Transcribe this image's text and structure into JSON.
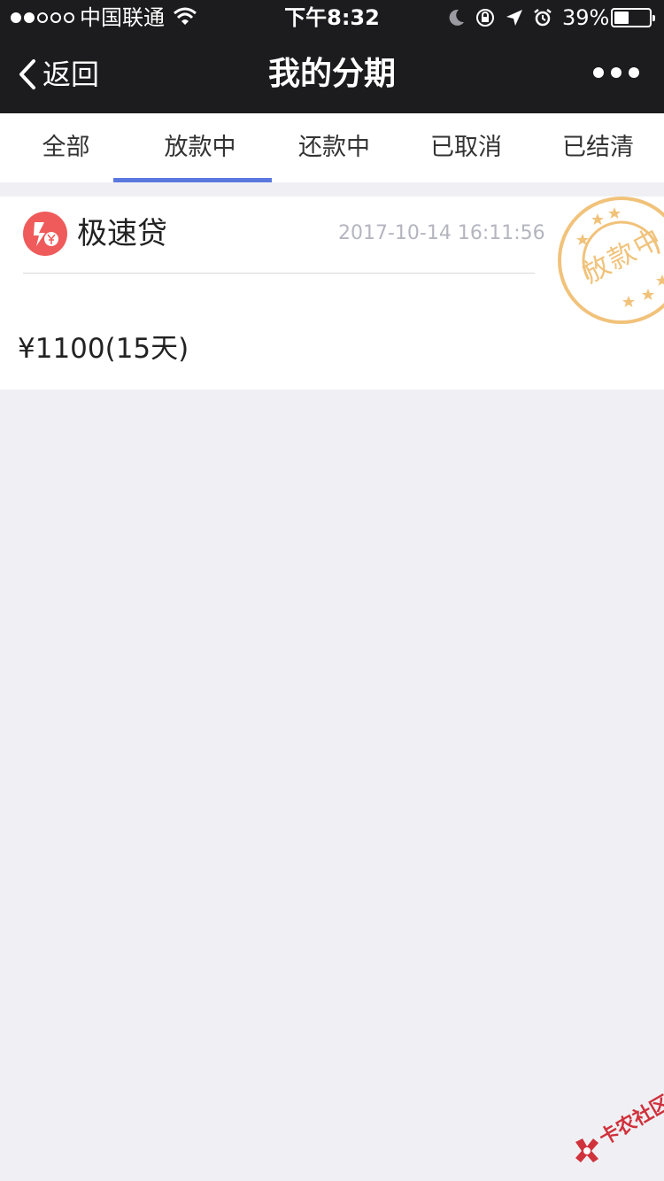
{
  "status_bar": {
    "carrier": "中国联通",
    "time": "下午8:32",
    "battery_percent": "39%",
    "battery_level": 0.39,
    "signal_bars_filled": 2,
    "signal_bars_total": 5
  },
  "nav": {
    "back_label": "返回",
    "title": "我的分期"
  },
  "tabs": [
    {
      "label": "全部",
      "active": false
    },
    {
      "label": "放款中",
      "active": true
    },
    {
      "label": "还款中",
      "active": false
    },
    {
      "label": "已取消",
      "active": false
    },
    {
      "label": "已结清",
      "active": false
    }
  ],
  "loan_card": {
    "product_name": "极速贷",
    "datetime": "2017-10-14 16:11:56",
    "amount": "¥1100(15天)",
    "stamp_text": "放款中",
    "stamp_color": "#f1c27a",
    "logo_color": "#ef5b5b"
  },
  "colors": {
    "accent": "#5b78e0",
    "header_bg": "#1c1c1e",
    "page_bg": "#f0f0f4"
  },
  "watermark": {
    "text": "卡农社区"
  }
}
